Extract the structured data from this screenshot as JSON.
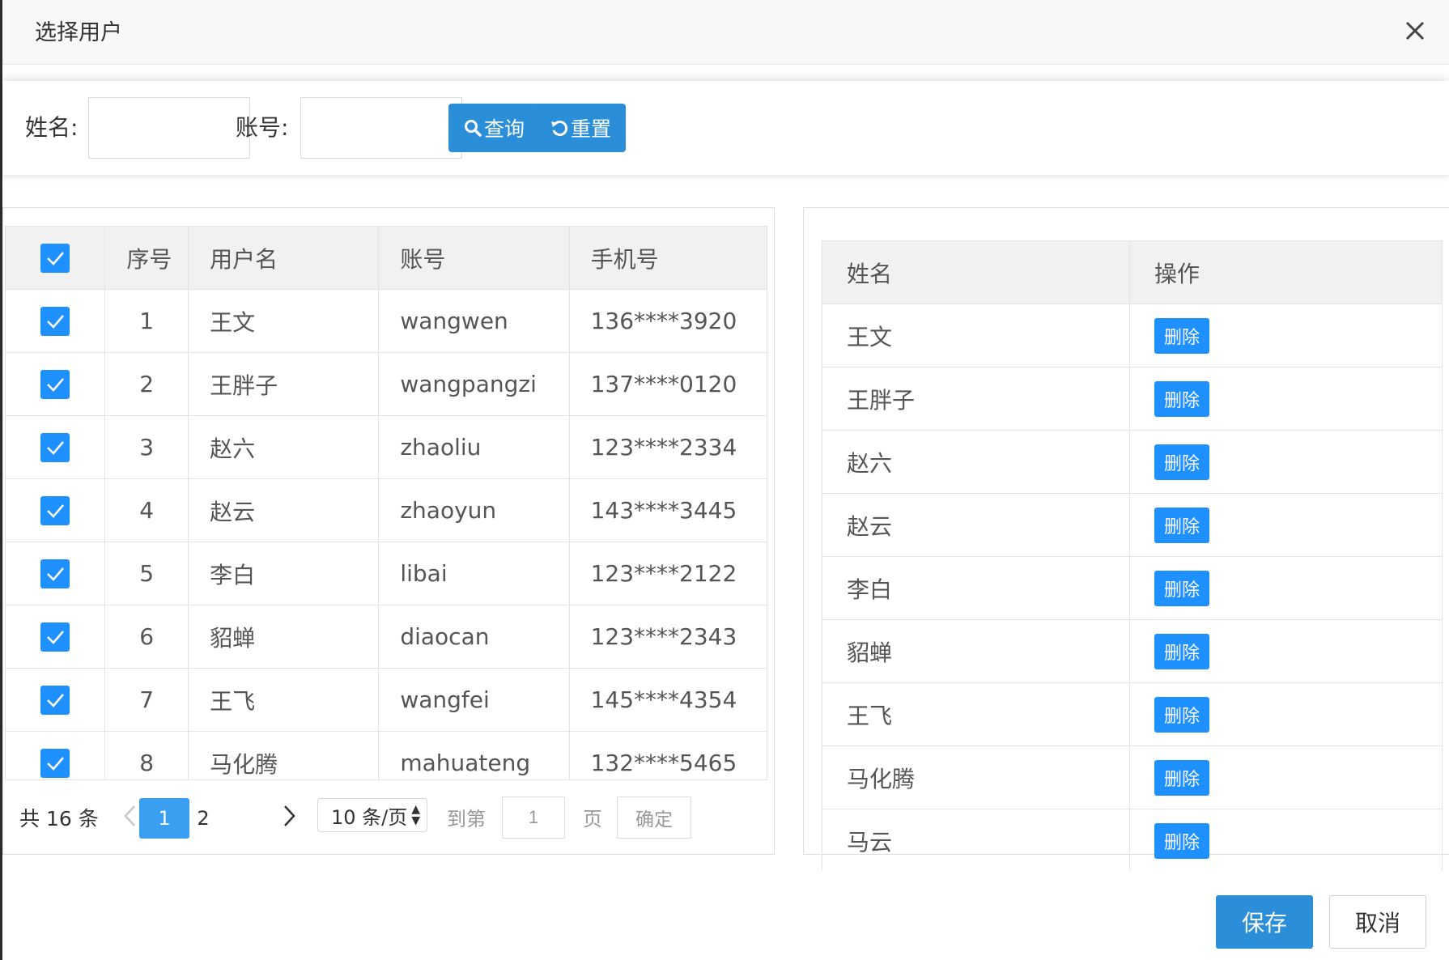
{
  "dialog": {
    "title": "选择用户"
  },
  "search": {
    "name_label": "姓名:",
    "name_value": "",
    "account_label": "账号:",
    "account_value": "",
    "query_label": "查询",
    "reset_label": "重置"
  },
  "left_table": {
    "columns": [
      "序号",
      "用户名",
      "账号",
      "手机号"
    ],
    "header_checked": true,
    "rows": [
      {
        "index": "1",
        "username": "王文",
        "account": "wangwen",
        "phone": "136****3920",
        "checked": true
      },
      {
        "index": "2",
        "username": "王胖子",
        "account": "wangpangzi",
        "phone": "137****0120",
        "checked": true
      },
      {
        "index": "3",
        "username": "赵六",
        "account": "zhaoliu",
        "phone": "123****2334",
        "checked": true
      },
      {
        "index": "4",
        "username": "赵云",
        "account": "zhaoyun",
        "phone": "143****3445",
        "checked": true
      },
      {
        "index": "5",
        "username": "李白",
        "account": "libai",
        "phone": "123****2122",
        "checked": true
      },
      {
        "index": "6",
        "username": "貂蝉",
        "account": "diaocan",
        "phone": "123****2343",
        "checked": true
      },
      {
        "index": "7",
        "username": "王飞",
        "account": "wangfei",
        "phone": "145****4354",
        "checked": true
      },
      {
        "index": "8",
        "username": "马化腾",
        "account": "mahuateng",
        "phone": "132****5465",
        "checked": true
      }
    ]
  },
  "pagination": {
    "total": "共 16 条",
    "pages": [
      "1",
      "2"
    ],
    "current_page": "1",
    "page_size": "10 条/页",
    "goto_label": "到第",
    "goto_value": "1",
    "page_label": "页",
    "confirm_label": "确定"
  },
  "right_table": {
    "columns": [
      "姓名",
      "操作"
    ],
    "delete_label": "删除",
    "rows": [
      "王文",
      "王胖子",
      "赵六",
      "赵云",
      "李白",
      "貂蝉",
      "王飞",
      "马化腾",
      "马云"
    ]
  },
  "footer": {
    "save_label": "保存",
    "cancel_label": "取消"
  },
  "colors": {
    "primary": "#2a8ed8",
    "checkbox": "#1e90ff",
    "active_page": "#3a9ff0"
  }
}
